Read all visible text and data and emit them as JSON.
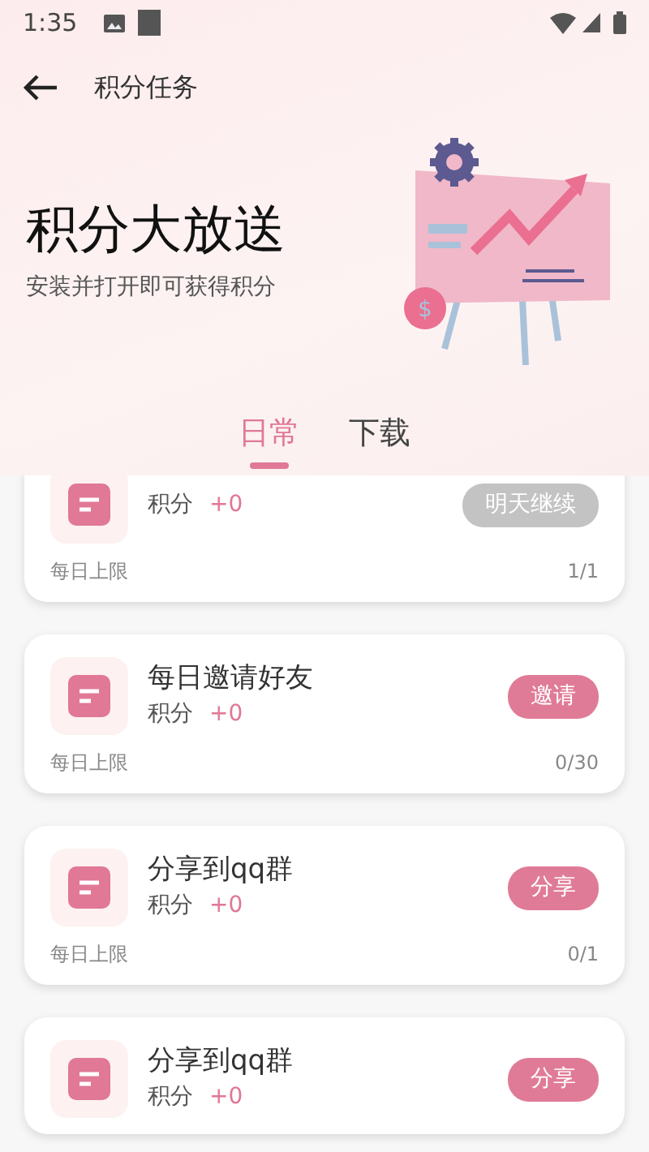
{
  "status_bar": {
    "time": "1:35"
  },
  "app_bar": {
    "title": "积分任务"
  },
  "hero": {
    "title": "积分大放送",
    "subtitle": "安装并打开即可获得积分",
    "coin_symbol": "$"
  },
  "tabs": [
    {
      "label": "日常",
      "selected": true
    },
    {
      "label": "下载",
      "selected": false
    }
  ],
  "tasks": [
    {
      "points_label": "积分",
      "points_value": "+0",
      "button": {
        "label": "明天继续",
        "disabled": true
      },
      "limit_label": "每日上限",
      "count": "1/1"
    },
    {
      "title": "每日邀请好友",
      "points_label": "积分",
      "points_value": "+0",
      "button": {
        "label": "邀请",
        "disabled": false
      },
      "limit_label": "每日上限",
      "count": "0/30"
    },
    {
      "title": "分享到qq群",
      "points_label": "积分",
      "points_value": "+0",
      "button": {
        "label": "分享",
        "disabled": false
      },
      "limit_label": "每日上限",
      "count": "0/1"
    },
    {
      "title": "分享到qq群",
      "points_label": "积分",
      "points_value": "+0",
      "button": {
        "label": "分享",
        "disabled": false
      }
    }
  ]
}
